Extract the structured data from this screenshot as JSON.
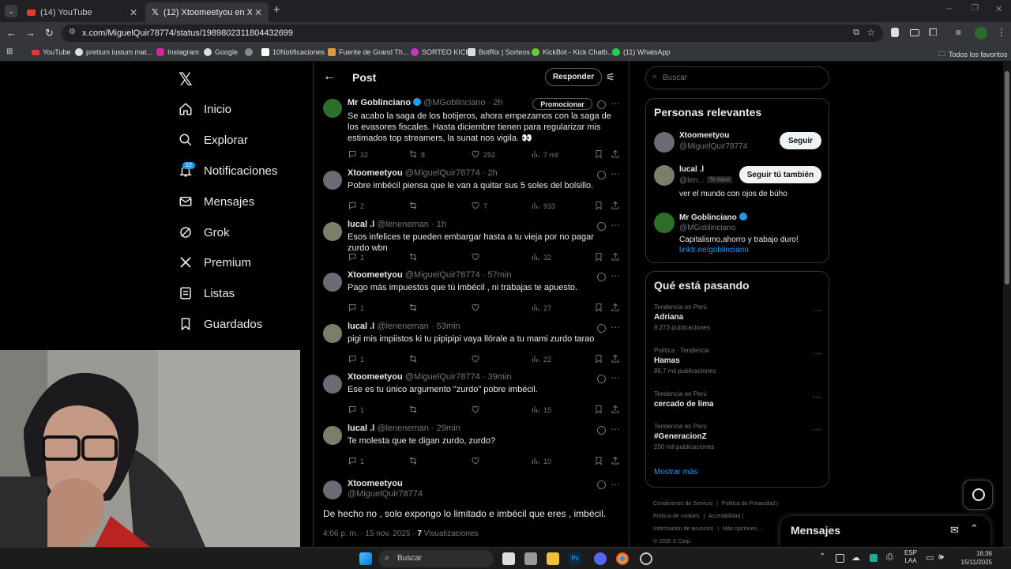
{
  "browser": {
    "tabs": [
      {
        "label": "(14) YouTube",
        "active": false
      },
      {
        "label": "(12) Xtoomeetyou en X: \"@lenen",
        "active": true
      }
    ],
    "url": "x.com/MiguelQuir78774/status/1989802311804432699",
    "bookmarks": [
      "YouTube",
      "pretium iustum mat...",
      "Instagram",
      "Google",
      "",
      "10Notificaciones",
      "Fuente de Grand Th...",
      "SORTEO KICK",
      "BotRix | Sorteos",
      "KickBot - Kick Chatb...",
      "(11) WhatsApp"
    ],
    "all_bookmarks": "Todos los favoritos"
  },
  "nav": {
    "items": [
      {
        "label": "Inicio",
        "icon": "home-icon"
      },
      {
        "label": "Explorar",
        "icon": "search-icon"
      },
      {
        "label": "Notificaciones",
        "icon": "bell-icon",
        "badge": "12"
      },
      {
        "label": "Mensajes",
        "icon": "mail-icon"
      },
      {
        "label": "Grok",
        "icon": "grok-icon"
      },
      {
        "label": "Premium",
        "icon": "x-logo-icon"
      },
      {
        "label": "Listas",
        "icon": "list-icon"
      },
      {
        "label": "Guardados",
        "icon": "bookmark-icon"
      }
    ]
  },
  "post": {
    "back": "←",
    "title": "Post",
    "reply_button": "Responder",
    "main": {
      "name": "Mr Goblinciano",
      "handle": "@MGoblinciano",
      "time": "· 2h",
      "promote": "Promocionar",
      "text": "Se acabo la saga de los botijeros, ahora empezamos con la saga de los evasores fiscales. Hasta diciembre tienen para regularizar mis estimados top streamers, la sunat nos vigila. 👀",
      "replies": "32",
      "reposts": "8",
      "likes": "292",
      "views": "7 mil"
    },
    "replies": [
      {
        "name": "Xtoomeetyou",
        "handle": "@MiguelQuir78774",
        "time": "· 2h",
        "text": "Pobre imbécil piensa que le van a quitar sus 5 soles del bolsillo.",
        "replies": "2",
        "reposts": "",
        "likes": "7",
        "views": "933"
      },
      {
        "name": "lucal .l",
        "handle": "@leneneman",
        "time": "· 1h",
        "text": "Esos infelices te pueden embargar hasta a tu vieja por no pagar zurdo wbn",
        "replies": "1",
        "reposts": "",
        "likes": "",
        "views": "32"
      },
      {
        "name": "Xtoomeetyou",
        "handle": "@MiguelQuir78774",
        "time": "· 57min",
        "text": "Pago más impuestos que tú imbécil , ni trabajas te apuesto.",
        "replies": "1",
        "reposts": "",
        "likes": "",
        "views": "27"
      },
      {
        "name": "lucal .l",
        "handle": "@leneneman",
        "time": "· 53min",
        "text": "pigi mis impiistos ki tu pipipipi vaya llórale a tu mami zurdo tarao",
        "replies": "1",
        "reposts": "",
        "likes": "",
        "views": "22"
      },
      {
        "name": "Xtoomeetyou",
        "handle": "@MiguelQuir78774",
        "time": "· 39min",
        "text": "Ese es tu único argumento \"zurdo\" pobre imbécil.",
        "replies": "1",
        "reposts": "",
        "likes": "",
        "views": "15"
      },
      {
        "name": "lucal .l",
        "handle": "@leneneman",
        "time": "· 29min",
        "text": "Te molesta que te digan zurdo, zurdo?",
        "replies": "1",
        "reposts": "",
        "likes": "",
        "views": "10"
      }
    ],
    "focus": {
      "name": "Xtoomeetyou",
      "handle": "@MiguelQuir78774",
      "text": "De hecho no , solo expongo lo limitado e imbécil que eres , imbécil.",
      "meta": "4:06 p. m. · 15 nov. 2025 ·",
      "views_count": "7",
      "views_label": "Visualizaciones"
    }
  },
  "sidebar": {
    "search_placeholder": "Buscar",
    "relevant_title": "Personas relevantes",
    "people": [
      {
        "name": "Xtoomeetyou",
        "handle": "@MiguelQuir78774",
        "button": "Seguir",
        "bio": "",
        "follows_you": "",
        "link": ""
      },
      {
        "name": "lucal .l",
        "handle": "@len...",
        "button": "Seguir tú también",
        "bio": "ver el mundo con ojos de búho",
        "follows_you": "Te sigue",
        "link": ""
      },
      {
        "name": "Mr Goblinciano",
        "handle": "@MGoblinciano",
        "button": "",
        "bio": "Capitalismo,ahorro y trabajo duro!",
        "follows_you": "",
        "link": "linktr.ee/goblinciano"
      }
    ],
    "trends_title": "Qué está pasando",
    "trends": [
      {
        "context": "Tendencia en Perú",
        "name": "Adriana",
        "posts": "8.273 publicaciones"
      },
      {
        "context": "Política · Tendencia",
        "name": "Hamas",
        "posts": "86,7 mil publicaciones"
      },
      {
        "context": "Tendencia en Perú",
        "name": "cercado de lima",
        "posts": ""
      },
      {
        "context": "Tendencia en Perú",
        "name": "#GeneracionZ",
        "posts": "200 mil publicaciones"
      }
    ],
    "show_more": "Mostrar más",
    "footer": [
      "Condiciones de Servicio",
      "Política de Privacidad",
      "Política de cookies",
      "Accesibilidad",
      "Información de anuncios",
      "Más opciones ...",
      "© 2025 X Corp."
    ]
  },
  "messages_drawer": {
    "label": "Mensajes"
  },
  "taskbar": {
    "search": "Buscar",
    "lang1": "ESP",
    "lang2": "LAA",
    "time": "16:36",
    "date": "15/11/2025"
  },
  "colors": {
    "accent": "#1d9bf0",
    "bg": "#000000",
    "border": "#2f3336",
    "muted": "#71767b"
  }
}
